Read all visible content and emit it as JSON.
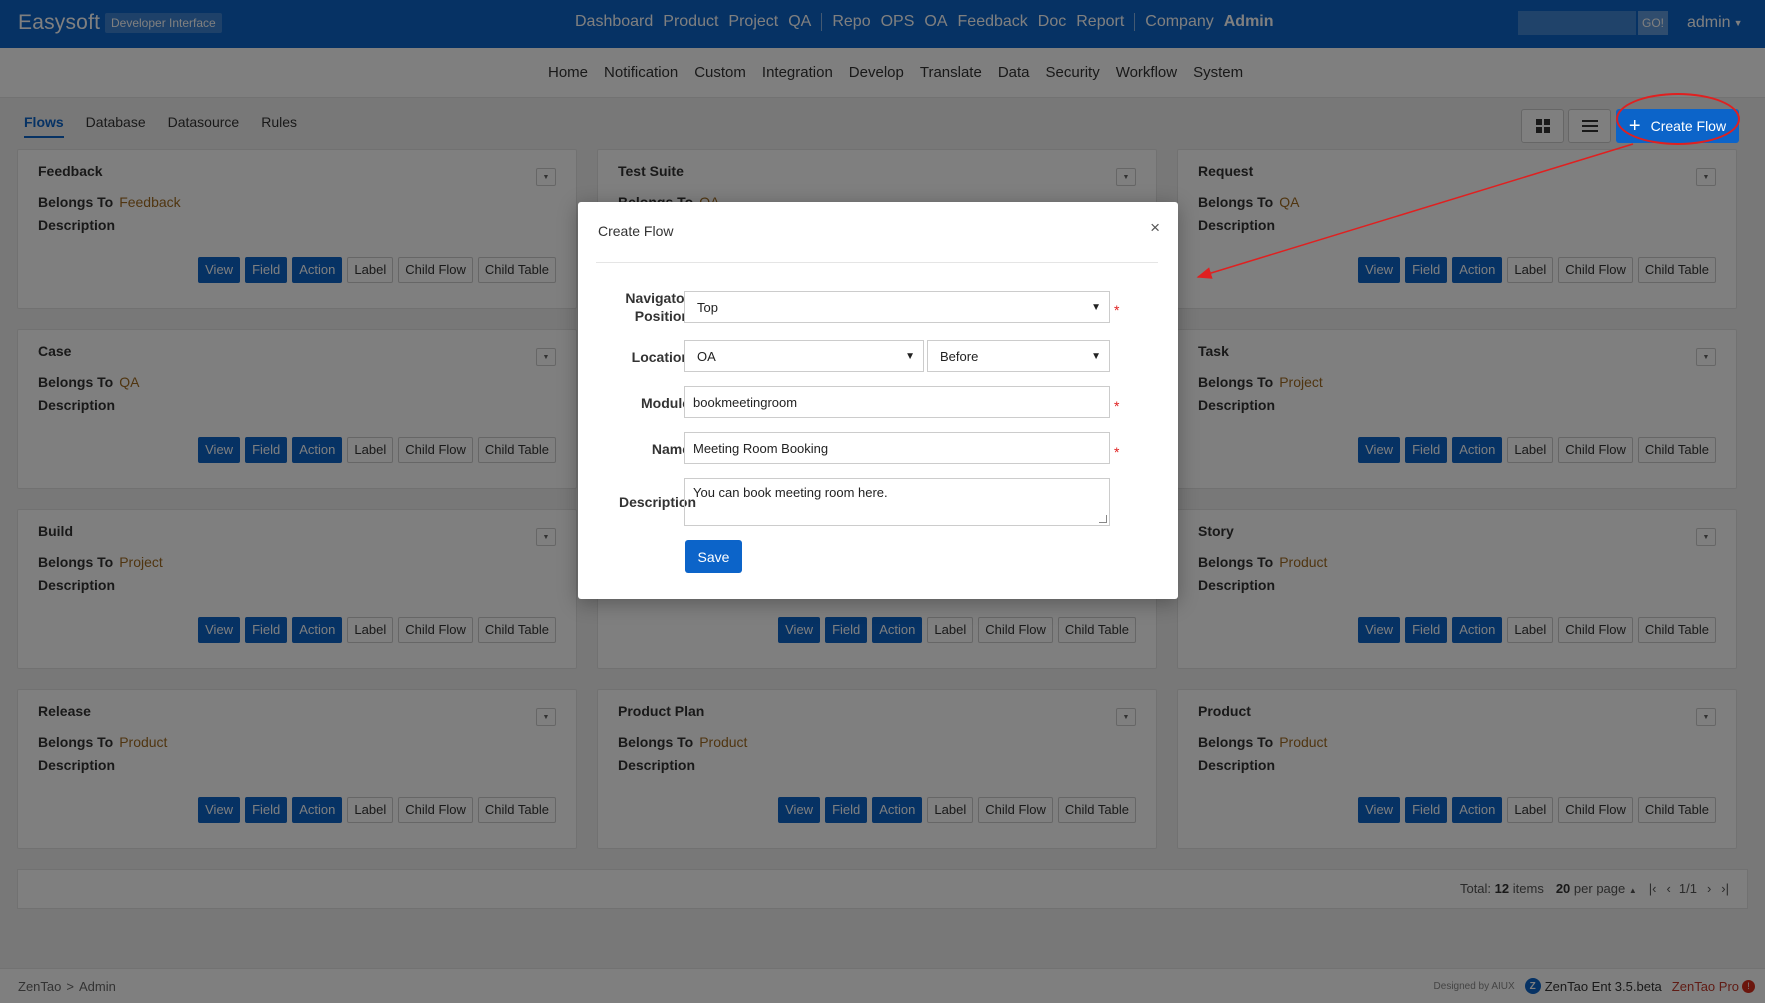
{
  "topbar": {
    "brand": "Easysoft",
    "badge": "Developer Interface",
    "nav_group1": [
      "Dashboard",
      "Product",
      "Project",
      "QA"
    ],
    "nav_group2": [
      "Repo",
      "OPS",
      "OA",
      "Feedback",
      "Doc",
      "Report"
    ],
    "nav_group3": [
      "Company"
    ],
    "nav_active": "Admin",
    "search_placeholder": "",
    "go_label": "GO!",
    "user": "admin"
  },
  "subnav": [
    "Home",
    "Notification",
    "Custom",
    "Integration",
    "Develop",
    "Translate",
    "Data",
    "Security",
    "Workflow",
    "System"
  ],
  "tabs": {
    "items": [
      "Flows",
      "Database",
      "Datasource",
      "Rules"
    ],
    "active": "Flows"
  },
  "create_button_label": "Create Flow",
  "card_labels": {
    "belongs_to": "Belongs To",
    "description": "Description",
    "buttons": [
      "View",
      "Field",
      "Action",
      "Label",
      "Child Flow",
      "Child Table"
    ]
  },
  "cards": [
    {
      "title": "Feedback",
      "belongs": "Feedback"
    },
    {
      "title": "Test Suite",
      "belongs": "QA"
    },
    {
      "title": "Request",
      "belongs": "QA"
    },
    {
      "title": "Case",
      "belongs": "QA"
    },
    {
      "title": "",
      "belongs": ""
    },
    {
      "title": "Task",
      "belongs": "Project"
    },
    {
      "title": "Build",
      "belongs": "Project"
    },
    {
      "title": "",
      "belongs": ""
    },
    {
      "title": "Story",
      "belongs": "Product"
    },
    {
      "title": "Release",
      "belongs": "Product"
    },
    {
      "title": "Product Plan",
      "belongs": "Product"
    },
    {
      "title": "Product",
      "belongs": "Product"
    }
  ],
  "pager": {
    "total_prefix": "Total:",
    "total_count": "12",
    "total_suffix": "items",
    "per_page_count": "20",
    "per_page_suffix": "per page",
    "page": "1/1"
  },
  "footer": {
    "crumb": [
      "ZenTao",
      "Admin"
    ],
    "designed_by": "Designed by AIUX",
    "edition": "ZenTao Ent 3.5.beta",
    "pro": "ZenTao Pro"
  },
  "modal": {
    "title": "Create Flow",
    "close": "×",
    "navigator_label": "Navigator Position",
    "navigator_value": "Top",
    "location_label": "Location",
    "location_value": "OA",
    "location_pos_value": "Before",
    "module_label": "Module",
    "module_value": "bookmeetingroom",
    "name_label": "Name",
    "name_value": "Meeting Room Booking",
    "description_label": "Description",
    "description_value": "You can book meeting room here.",
    "save_label": "Save",
    "required_mark": "*"
  },
  "colors": {
    "accent": "#0c64c9",
    "belongs_value": "#a06b20",
    "annotation": "#e02020"
  }
}
